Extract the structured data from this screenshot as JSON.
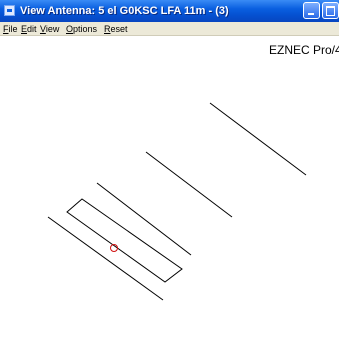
{
  "window": {
    "title": "View Antenna: 5 el G0KSC LFA 11m - (3)"
  },
  "menu": {
    "items": [
      {
        "first": "F",
        "rest": "ile"
      },
      {
        "first": "E",
        "rest": "dit"
      },
      {
        "first": "V",
        "rest": "iew"
      },
      {
        "first": "O",
        "rest": "ptions"
      },
      {
        "first": "R",
        "rest": "eset"
      }
    ]
  },
  "view": {
    "brand": "EZNEC Pro/4",
    "element_color": "#000000",
    "source_color": "#d01010"
  }
}
